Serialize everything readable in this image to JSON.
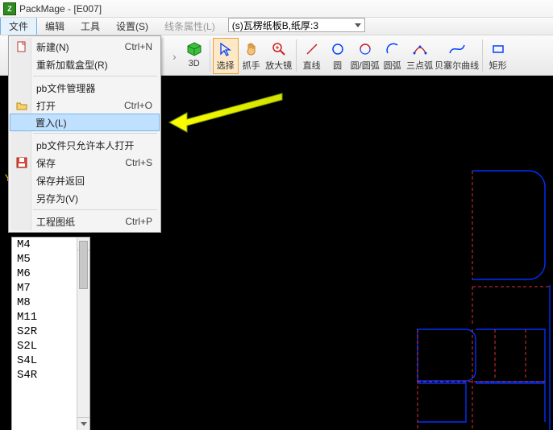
{
  "title": "PackMage - [E007]",
  "menubar": {
    "file": "文件",
    "edit": "编辑",
    "tool": "工具",
    "settings": "设置(S)",
    "lineprops": "线条属性(L)"
  },
  "material_selected": "(s)瓦楞纸板B,纸厚:3",
  "toolbar": {
    "threeD": "3D",
    "select": "选择",
    "hand": "抓手",
    "zoom": "放大镜",
    "line": "直线",
    "circle": "圆",
    "arc": "圆/圆弧",
    "arc2": "圆弧",
    "arc3pt": "三点弧",
    "bezier": "贝塞尔曲线",
    "rect": "矩形"
  },
  "file_menu": {
    "new": "新建(N)",
    "new_short": "Ctrl+N",
    "reload": "重新加载盒型(R)",
    "manager": "pb文件管理器",
    "open": "打开",
    "open_short": "Ctrl+O",
    "insert": "置入(L)",
    "lockopen": "pb文件只允许本人打开",
    "save": "保存",
    "save_short": "Ctrl+S",
    "saveback": "保存并返回",
    "saveas": "另存为(V)",
    "engdraw": "工程图纸",
    "engdraw_short": "Ctrl+P"
  },
  "list": [
    "M4",
    "M5",
    "M6",
    "M7",
    "M8",
    "M11",
    "S2R",
    "S2L",
    "S4L",
    "S4R"
  ],
  "axis": {
    "y": "Y"
  },
  "colors": {
    "highlight": "#bfe0ff",
    "arrow": "#ffff00"
  }
}
